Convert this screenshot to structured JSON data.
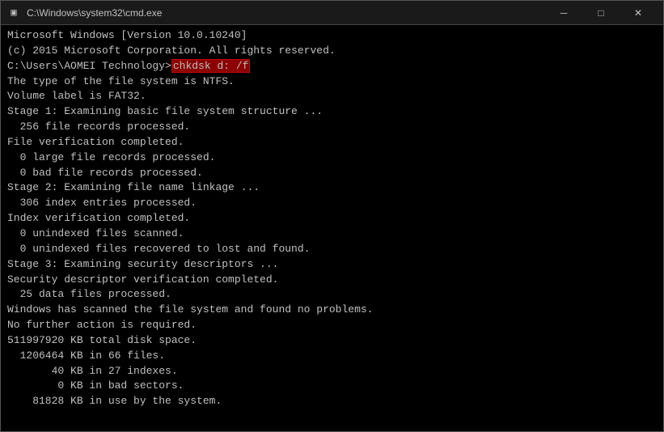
{
  "titleBar": {
    "icon": "▣",
    "title": "C:\\Windows\\system32\\cmd.exe",
    "minimizeLabel": "─",
    "maximizeLabel": "□",
    "closeLabel": "✕"
  },
  "terminal": {
    "lines": [
      {
        "text": "Microsoft Windows [Version 10.0.10240]",
        "type": "normal"
      },
      {
        "text": "(c) 2015 Microsoft Corporation. All rights reserved.",
        "type": "normal"
      },
      {
        "text": "",
        "type": "normal"
      },
      {
        "text": "C:\\Users\\AOMEI Technology>chkdsk d: /f",
        "type": "prompt",
        "highlight": "chkdsk d: /f"
      },
      {
        "text": "The type of the file system is NTFS.",
        "type": "normal"
      },
      {
        "text": "Volume label is FAT32.",
        "type": "normal"
      },
      {
        "text": "",
        "type": "normal"
      },
      {
        "text": "Stage 1: Examining basic file system structure ...",
        "type": "normal"
      },
      {
        "text": "  256 file records processed.",
        "type": "normal"
      },
      {
        "text": "File verification completed.",
        "type": "normal"
      },
      {
        "text": "  0 large file records processed.",
        "type": "normal"
      },
      {
        "text": "  0 bad file records processed.",
        "type": "normal"
      },
      {
        "text": "",
        "type": "normal"
      },
      {
        "text": "Stage 2: Examining file name linkage ...",
        "type": "normal"
      },
      {
        "text": "  306 index entries processed.",
        "type": "normal"
      },
      {
        "text": "Index verification completed.",
        "type": "normal"
      },
      {
        "text": "  0 unindexed files scanned.",
        "type": "normal"
      },
      {
        "text": "  0 unindexed files recovered to lost and found.",
        "type": "normal"
      },
      {
        "text": "",
        "type": "normal"
      },
      {
        "text": "Stage 3: Examining security descriptors ...",
        "type": "normal"
      },
      {
        "text": "Security descriptor verification completed.",
        "type": "normal"
      },
      {
        "text": "  25 data files processed.",
        "type": "normal"
      },
      {
        "text": "",
        "type": "normal"
      },
      {
        "text": "Windows has scanned the file system and found no problems.",
        "type": "normal"
      },
      {
        "text": "No further action is required.",
        "type": "normal"
      },
      {
        "text": "",
        "type": "normal"
      },
      {
        "text": "511997920 KB total disk space.",
        "type": "normal"
      },
      {
        "text": "  1206464 KB in 66 files.",
        "type": "normal"
      },
      {
        "text": "       40 KB in 27 indexes.",
        "type": "normal"
      },
      {
        "text": "        0 KB in bad sectors.",
        "type": "normal"
      },
      {
        "text": "    81828 KB in use by the system.",
        "type": "normal"
      }
    ]
  }
}
